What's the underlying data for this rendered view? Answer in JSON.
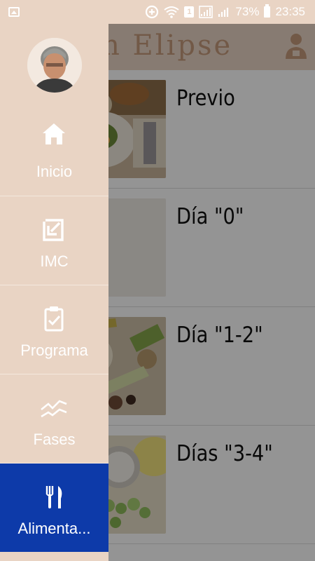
{
  "status_bar": {
    "battery_percent": "73%",
    "time": "23:35",
    "sim_badge": "1"
  },
  "app_bar": {
    "title": "ón Elipse"
  },
  "list": {
    "items": [
      {
        "label": "Previo"
      },
      {
        "label": "Día \"0\""
      },
      {
        "label": "Día \"1-2\""
      },
      {
        "label": "Días \"3-4\""
      }
    ]
  },
  "drawer": {
    "items": [
      {
        "label": "Inicio",
        "icon": "home-icon"
      },
      {
        "label": "IMC",
        "icon": "edit-arrow-icon"
      },
      {
        "label": "Programa",
        "icon": "clipboard-check-icon"
      },
      {
        "label": "Fases",
        "icon": "trend-lines-icon"
      },
      {
        "label": "Alimenta...",
        "icon": "fork-knife-icon"
      }
    ],
    "active_index": 4
  },
  "colors": {
    "drawer_bg": "#e9d4c4",
    "active_bg": "#0d3aa9",
    "title_color": "#c59a7b"
  }
}
